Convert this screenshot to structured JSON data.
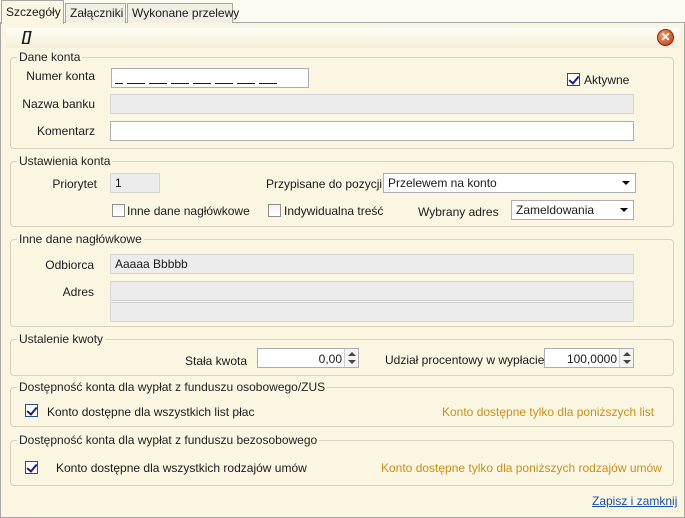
{
  "tabs": [
    "Szczegóły",
    "Załączniki",
    "Wykonane przelewy"
  ],
  "header": {
    "bracket": "[]",
    "close_icon": "close-icon"
  },
  "dane_konta": {
    "legend": "Dane konta",
    "numer_konta_label": "Numer konta",
    "aktywne_label": "Aktywne",
    "aktywne_checked": true,
    "nazwa_banku_label": "Nazwa banku",
    "nazwa_banku_value": "",
    "komentarz_label": "Komentarz",
    "komentarz_value": ""
  },
  "ustawienia": {
    "legend": "Ustawienia konta",
    "priorytet_label": "Priorytet",
    "priorytet_value": "1",
    "przypisane_label": "Przypisane do pozycji",
    "przypisane_value": "Przelewem na konto",
    "inne_dane_label": "Inne dane nagłówkowe",
    "inne_dane_checked": false,
    "indywidualna_label": "Indywidualna treść",
    "indywidualna_checked": false,
    "wybrany_adres_label": "Wybrany adres",
    "wybrany_adres_value": "Zameldowania"
  },
  "inne_dane": {
    "legend": "Inne dane nagłówkowe",
    "odbiorca_label": "Odbiorca",
    "odbiorca_value": "Aaaaa Bbbbb",
    "adres_label": "Adres",
    "adres_line1": "",
    "adres_line2": ""
  },
  "kwota": {
    "legend": "Ustalenie kwoty",
    "stala_label": "Stała kwota",
    "stala_value": "0,00",
    "udzial_label": "Udział procentowy w wypłacie",
    "udzial_value": "100,0000"
  },
  "osobowy": {
    "legend": "Dostępność konta dla wypłat z funduszu osobowego/ZUS",
    "all_label": "Konto dostępne dla wszystkich list płac",
    "all_checked": true,
    "only_label": "Konto dostępne tylko dla poniższych list"
  },
  "bezosobowy": {
    "legend": "Dostępność konta dla wypłat z funduszu bezosobowego",
    "all_label": "Konto dostępne dla wszystkich rodzajów umów",
    "all_checked": true,
    "only_label": "Konto dostępne tylko dla poniższych rodzajów umów"
  },
  "footer": {
    "save_close": "Zapisz i zamknij"
  }
}
